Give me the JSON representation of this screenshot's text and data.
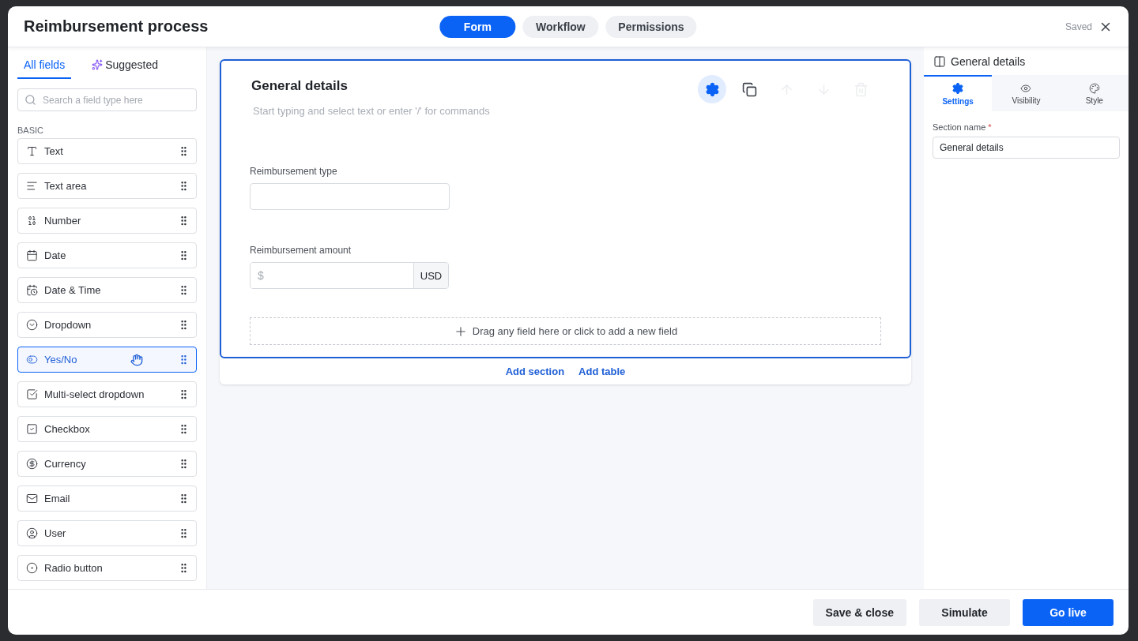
{
  "window": {
    "title": "Reimbursement process",
    "status": "Saved"
  },
  "mode_tabs": [
    {
      "label": "Form",
      "selected": true
    },
    {
      "label": "Workflow",
      "selected": false
    },
    {
      "label": "Permissions",
      "selected": false
    }
  ],
  "sidebar": {
    "tabs": [
      {
        "label": "All fields",
        "selected": true,
        "kind": "plain"
      },
      {
        "label": "Suggested",
        "selected": false,
        "kind": "ai"
      }
    ],
    "search": {
      "placeholder": "Search a field type here"
    },
    "group": "BASIC",
    "items": [
      {
        "label": "Text",
        "kind": "text",
        "selected": false
      },
      {
        "label": "Text area",
        "kind": "textarea",
        "selected": false
      },
      {
        "label": "Number",
        "kind": "number",
        "selected": false
      },
      {
        "label": "Date",
        "kind": "date",
        "selected": false
      },
      {
        "label": "Date & Time",
        "kind": "datetime",
        "selected": false
      },
      {
        "label": "Dropdown",
        "kind": "dropdown",
        "selected": false
      },
      {
        "label": "Yes/No",
        "kind": "yesno",
        "selected": true
      },
      {
        "label": "Multi-select dropdown",
        "kind": "multiselect",
        "selected": false
      },
      {
        "label": "Checkbox",
        "kind": "checkbox",
        "selected": false
      },
      {
        "label": "Currency",
        "kind": "currency",
        "selected": false
      },
      {
        "label": "Email",
        "kind": "email",
        "selected": false
      },
      {
        "label": "User",
        "kind": "user",
        "selected": false
      },
      {
        "label": "Radio button",
        "kind": "radio",
        "selected": false
      }
    ]
  },
  "section": {
    "title": "General details",
    "placeholder": "Start typing and select text or enter '/' for commands",
    "tools": [
      {
        "kind": "settings",
        "selected": true,
        "disabled": false
      },
      {
        "kind": "copy",
        "selected": false,
        "disabled": false
      },
      {
        "kind": "up",
        "selected": false,
        "disabled": true
      },
      {
        "kind": "down",
        "selected": false,
        "disabled": true
      },
      {
        "kind": "delete",
        "selected": false,
        "disabled": true
      }
    ],
    "fields": [
      {
        "label": "Reimbursement type",
        "kind": "text"
      },
      {
        "label": "Reimbursement amount",
        "kind": "currency",
        "placeholder": "$",
        "unit": "USD"
      }
    ],
    "drop_hint": "Drag any field here or click to add a new field"
  },
  "section_actions": [
    "Add section",
    "Add table"
  ],
  "properties": {
    "title": "General details",
    "tabs": [
      {
        "label": "Settings",
        "kind": "settings",
        "selected": true
      },
      {
        "label": "Visibility",
        "kind": "visibility",
        "selected": false
      },
      {
        "label": "Style",
        "kind": "style",
        "selected": false
      }
    ],
    "field_label": "Section name",
    "required_mark": "*",
    "value": "General details"
  },
  "footer": [
    {
      "label": "Save & close",
      "kind": "secondary"
    },
    {
      "label": "Simulate",
      "kind": "secondary"
    },
    {
      "label": "Go live",
      "kind": "primary"
    }
  ]
}
